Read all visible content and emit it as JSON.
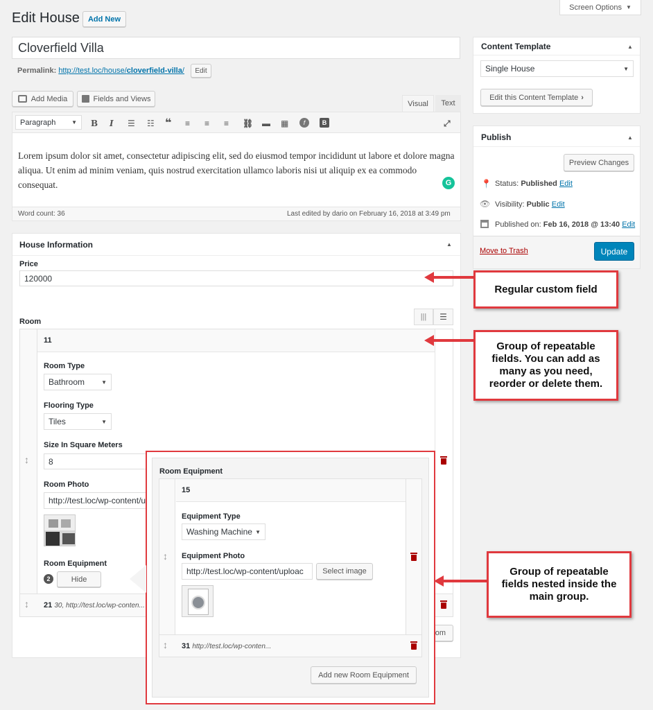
{
  "header": {
    "title": "Edit House",
    "add_new": "Add New",
    "screen_options": "Screen Options"
  },
  "post": {
    "title_value": "Cloverfield Villa",
    "permalink_label": "Permalink:",
    "permalink_base": "http://test.loc/house/",
    "permalink_slug": "cloverfield-villa",
    "permalink_tail": "/",
    "permalink_edit": "Edit"
  },
  "editor": {
    "add_media": "Add Media",
    "fields_and_views": "Fields and Views",
    "tab_visual": "Visual",
    "tab_text": "Text",
    "format_select": "Paragraph",
    "content": "Lorem ipsum dolor sit amet, consectetur adipiscing elit, sed do eiusmod tempor incididunt ut labore et dolore magna aliqua. Ut enim ad minim veniam, quis nostrud exercitation ullamco laboris nisi ut aliquip ex ea commodo consequat.",
    "word_count": "Word count: 36",
    "last_edited": "Last edited by dario on February 16, 2018 at 3:49 pm"
  },
  "house_info": {
    "title": "House Information",
    "price_label": "Price",
    "price_value": "120000",
    "room_label": "Room",
    "room_item_id": "11",
    "room_type_label": "Room Type",
    "room_type_value": "Bathroom",
    "flooring_label": "Flooring Type",
    "flooring_value": "Tiles",
    "size_label": "Size In Square Meters",
    "size_value": "8",
    "photo_label": "Room Photo",
    "photo_value": "http://test.loc/wp-content/u",
    "equipment_label": "Room Equipment",
    "equipment_count": "2",
    "hide_button": "Hide",
    "room2_id": "21",
    "room2_summary": "30, http://test.loc/wp-conten...",
    "add_room_partial": "oom"
  },
  "equipment_popup": {
    "title": "Room Equipment",
    "item_id": "15",
    "type_label": "Equipment Type",
    "type_value": "Washing Machine",
    "photo_label": "Equipment Photo",
    "photo_value": "http://test.loc/wp-content/uploac",
    "select_image": "Select image",
    "item2_id": "31",
    "item2_summary": "http://test.loc/wp-conten...",
    "add_new": "Add new Room Equipment"
  },
  "sidebar": {
    "content_template_title": "Content Template",
    "template_value": "Single House",
    "edit_template": "Edit this Content Template",
    "publish_title": "Publish",
    "preview_changes": "Preview Changes",
    "status_label": "Status:",
    "status_value": "Published",
    "status_edit": "Edit",
    "visibility_label": "Visibility:",
    "visibility_value": "Public",
    "visibility_edit": "Edit",
    "published_label": "Published on:",
    "published_value": "Feb 16, 2018 @ 13:40",
    "published_edit": "Edit",
    "move_to_trash": "Move to Trash",
    "update": "Update"
  },
  "callouts": {
    "regular": "Regular custom field",
    "group": "Group of repeatable fields. You can add as many as you need, reorder or delete them.",
    "nested": "Group of repeatable fields nested inside the main group."
  },
  "colors": {
    "accent": "#0073aa",
    "update_button": "#0085ba",
    "trash": "#a00",
    "callout_border": "#e0393e",
    "grammarly": "#15c39a"
  }
}
